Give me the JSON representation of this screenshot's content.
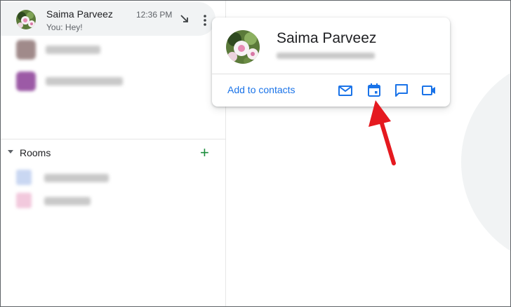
{
  "chat_list": {
    "active_dm": {
      "name": "Saima Parveez",
      "preview": "You: Hey!",
      "time": "12:36 PM",
      "avatar_icon": "flower-avatar-icon",
      "open_icon": "open-in-popup-icon",
      "more_icon": "more-vert-icon"
    },
    "blurred_dms": [
      {
        "avatar_color": "#a08a8a"
      },
      {
        "avatar_color": "#9c5aa6"
      }
    ]
  },
  "rooms": {
    "label": "Rooms",
    "add_icon": "plus-icon",
    "blurred_rooms": [
      {
        "avatar_color": "#c9d7f2"
      },
      {
        "avatar_color": "#f2c9dd"
      }
    ]
  },
  "profile_card": {
    "name": "Saima Parveez",
    "add_contacts_label": "Add to contacts",
    "actions": [
      "mail-icon",
      "calendar-icon",
      "chat-icon",
      "video-icon"
    ]
  },
  "colors": {
    "accent": "#1a73e8",
    "add_green": "#1e8e3e",
    "annotation_red": "#e5191f"
  }
}
